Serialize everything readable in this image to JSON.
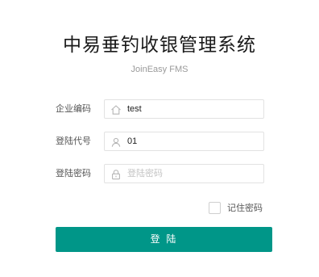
{
  "header": {
    "title": "中易垂钓收银管理系统",
    "subtitle": "JoinEasy FMS"
  },
  "form": {
    "company_code": {
      "label": "企业编码",
      "value": "test",
      "icon": "home-icon"
    },
    "login_id": {
      "label": "登陆代号",
      "value": "01",
      "icon": "user-icon"
    },
    "password": {
      "label": "登陆密码",
      "value": "",
      "placeholder": "登陆密码",
      "icon": "lock-icon"
    },
    "remember": {
      "label": "记住密码",
      "checked": false
    },
    "submit_label": "登 陆"
  },
  "colors": {
    "accent": "#009688",
    "icon": "#b5b5b5"
  }
}
